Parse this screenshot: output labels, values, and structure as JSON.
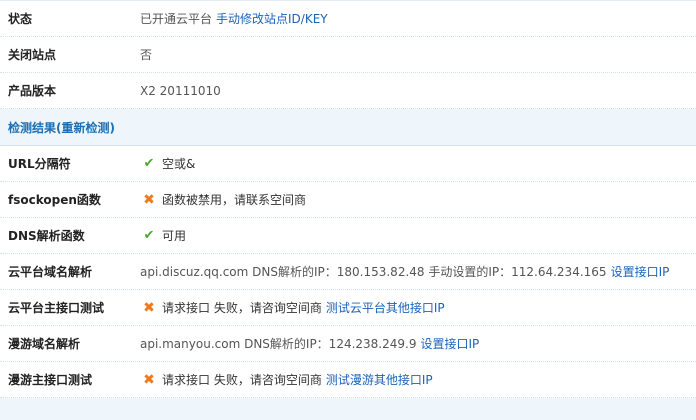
{
  "rows": [
    {
      "label": "状态",
      "status_text": "已开通云平台",
      "link": "手动修改站点ID/KEY"
    },
    {
      "label": "关闭站点",
      "value": "否"
    },
    {
      "label": "产品版本",
      "value": "X2 20111010"
    }
  ],
  "section": {
    "title": "检测结果(重新检测)"
  },
  "checks": [
    {
      "label": "URL分隔符",
      "icon": "check-icon",
      "value": "空或&"
    },
    {
      "label": "fsockopen函数",
      "icon": "cross-icon",
      "value": "函数被禁用，请联系空间商"
    },
    {
      "label": "DNS解析函数",
      "icon": "check-icon",
      "value": "可用"
    },
    {
      "label": "云平台域名解析",
      "value": "api.discuz.qq.com DNS解析的IP：180.153.82.48 手动设置的IP：112.64.234.165",
      "link": "设置接口IP"
    },
    {
      "label": "云平台主接口测试",
      "icon": "cross-icon",
      "value": "请求接口 失败，请咨询空间商",
      "link": "测试云平台其他接口IP"
    },
    {
      "label": "漫游域名解析",
      "value": "api.manyou.com DNS解析的IP：124.238.249.9",
      "link": "设置接口IP"
    },
    {
      "label": "漫游主接口测试",
      "icon": "cross-icon",
      "value": "请求接口 失败，请咨询空间商",
      "link": "测试漫游其他接口IP"
    }
  ],
  "icons": {
    "check": "✔",
    "cross": "✖"
  },
  "colors": {
    "link": "#1c62b9",
    "ok": "#4cab2f",
    "error": "#f07a1b",
    "section_bg": "#eef5fb"
  }
}
